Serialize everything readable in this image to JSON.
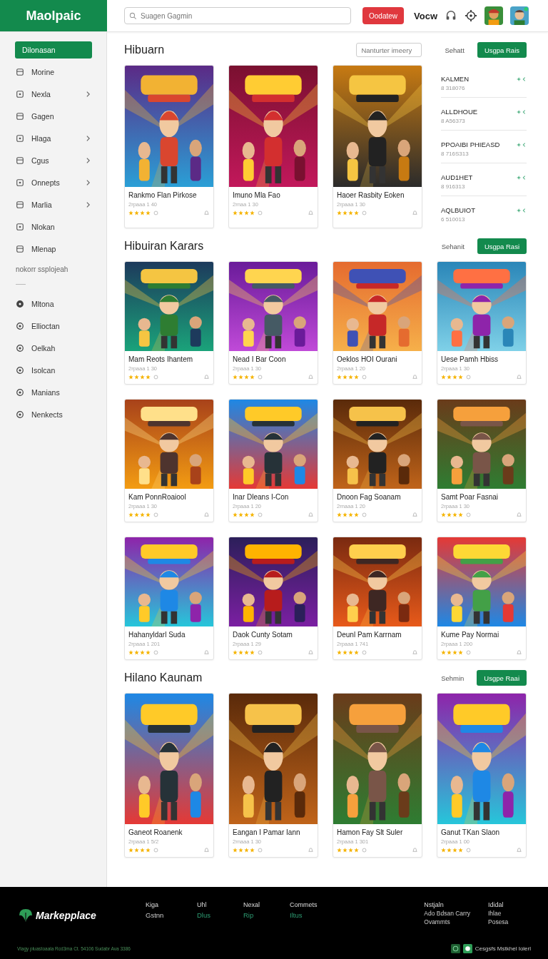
{
  "topbar": {
    "logo": "Maolpaic",
    "search": {
      "placeholder": "Suagen Gagmin"
    },
    "action_button": "Oodatew",
    "label": "Vocw"
  },
  "sidebar": {
    "items": [
      {
        "label": "Dilonasan",
        "selected": true,
        "expandable": false
      },
      {
        "label": "Morine",
        "selected": false,
        "expandable": false
      },
      {
        "label": "Nexla",
        "selected": false,
        "expandable": true
      },
      {
        "label": "Gagen",
        "selected": false,
        "expandable": false
      },
      {
        "label": "Hlaga",
        "selected": false,
        "expandable": true
      },
      {
        "label": "Cgus",
        "selected": false,
        "expandable": true
      },
      {
        "label": "Onnepts",
        "selected": false,
        "expandable": true
      },
      {
        "label": "Marlia",
        "selected": false,
        "expandable": true
      },
      {
        "label": "Nlokan",
        "selected": false,
        "expandable": false
      },
      {
        "label": "Mlenap",
        "selected": false,
        "expandable": false
      }
    ],
    "section_label": "nokorr ssplojeah",
    "items_2": [
      {
        "label": "Mltona",
        "selected": false
      },
      {
        "label": "Ellioctan",
        "selected": false
      },
      {
        "label": "Oelkah",
        "selected": false
      },
      {
        "label": "Isolcan",
        "selected": false
      },
      {
        "label": "Manians",
        "selected": false
      },
      {
        "label": "Nenkects",
        "selected": false
      }
    ]
  },
  "sections": [
    {
      "kind": "featured",
      "title": "Hibuarn",
      "filter": {
        "placeholder": "Nanturter imeery"
      },
      "link": "Sehatt",
      "button": "Usgpa Rais",
      "cards": [
        {
          "title": "Rankmo Flan Pirkose",
          "meta": "2rpaaa 1 40",
          "stars": 4
        },
        {
          "title": "Imuno Mla Fao",
          "meta": "2rnaa 1 30",
          "stars": 4
        },
        {
          "title": "Haoer Rasbity Eoken",
          "meta": "2rpaaa 1 30",
          "stars": 4
        }
      ],
      "list": [
        {
          "title": "KALMEN",
          "meta": "8 318076"
        },
        {
          "title": "ALLDHOUE",
          "meta": "8 A56373"
        },
        {
          "title": "PPOAIBI PHIEASD",
          "meta": "8 716S313"
        },
        {
          "title": "AUD1HET",
          "meta": "8 916313"
        },
        {
          "title": "AQLBUIOT",
          "meta": "6 510013"
        }
      ]
    },
    {
      "kind": "grid",
      "title": "Hibuiran Karars",
      "link": "Sehanit",
      "button": "Usgpa Rasi",
      "cards": [
        {
          "title": "Mam Reots Ihantem",
          "meta": "2rpaaa 1 30",
          "stars": 4
        },
        {
          "title": "Nead I Bar Coon",
          "meta": "2rpaaa 1 30",
          "stars": 4
        },
        {
          "title": "Oeklos HOI Ourani",
          "meta": "2rpaaa 1 20",
          "stars": 4
        },
        {
          "title": "Uese Pamh Hbiss",
          "meta": "2rpaaa 1 30",
          "stars": 4
        },
        {
          "title": "Kam PonnRoaiool",
          "meta": "2rpaaa 1 30",
          "stars": 4
        },
        {
          "title": "Inar Dleans I-Con",
          "meta": "2rpaaa 1 20",
          "stars": 4
        },
        {
          "title": "Dnoon Fag Soanam",
          "meta": "2rnaaa 1 20",
          "stars": 4
        },
        {
          "title": "Samt Poar Fasnai",
          "meta": "2rpaaa 1 30",
          "stars": 4
        },
        {
          "title": "Hahanyldarl Suda",
          "meta": "2rpaaa 1 201",
          "stars": 4
        },
        {
          "title": "Daok Cunty Sotam",
          "meta": "2rpaaa 1 29",
          "stars": 4
        },
        {
          "title": "Deunl Pam Karrnam",
          "meta": "2rpaaa 1 741",
          "stars": 4
        },
        {
          "title": "Kume Pay Normai",
          "meta": "2rpaaa 1 200",
          "stars": 4
        }
      ]
    },
    {
      "kind": "tall",
      "title": "Hilano Kaunam",
      "link": "Sehmin",
      "button": "Usgpe Raai",
      "cards": [
        {
          "title": "Ganeot Roanenk",
          "meta": "2rpaaa 1 5/2",
          "stars": 4
        },
        {
          "title": "Eangan I Pamar Iann",
          "meta": "2rnaaa 1 30",
          "stars": 4
        },
        {
          "title": "Hamon Fay Slt Suler",
          "meta": "2rpaaa 1 301",
          "stars": 4
        },
        {
          "title": "Ganut TKan Slaon",
          "meta": "2rpaaa 1 00",
          "stars": 4
        }
      ]
    }
  ],
  "footer": {
    "logo": "Markepplace",
    "columns": [
      {
        "heading": "Kiga",
        "link": "Gstnn",
        "highlight": false
      },
      {
        "heading": "Uhl",
        "link": "Dlus",
        "highlight": true
      },
      {
        "heading": "Nexal",
        "link": "Rip",
        "highlight": true
      },
      {
        "heading": "Commets",
        "link": "Iltus",
        "highlight": true
      }
    ],
    "info": [
      {
        "heading": "Nstjaln",
        "lines": [
          "Ado Bdsan Carry",
          "Ovammts"
        ]
      },
      {
        "heading": "Ididal",
        "lines": [
          "Ihlae",
          "Posesa"
        ]
      }
    ],
    "address": "Vlagy pluastoaala Rcd3ma Ct. 54106 Sudabr Ava 3386",
    "badge_text": "Cesgsfs Mstkhel Iolerl"
  }
}
